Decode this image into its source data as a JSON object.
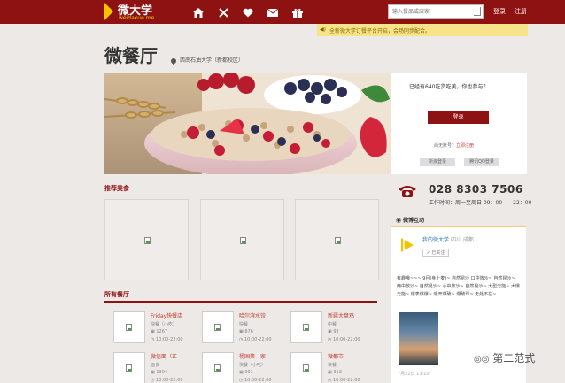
{
  "header": {
    "logo_text": "微大学",
    "logo_sub": "weidaxue.me",
    "nav_icons": [
      "home-icon",
      "utensils-icon",
      "heart-icon",
      "mail-icon",
      "gift-icon"
    ],
    "search_placeholder": "输入餐品或店家",
    "login_label": "登录",
    "register_label": "注册"
  },
  "notice": {
    "text": "全新微大学订餐平台开启，会场同步配合。"
  },
  "page": {
    "title": "微餐厅",
    "location": "西南石油大学（新都校区）"
  },
  "login_card": {
    "question": "已经有640吃货吃美，你也参与？",
    "button": "登录",
    "no_account": "尚无账号？",
    "register_link": "立即注册",
    "social_1": "新浪登录",
    "social_2": "腾讯QQ登录"
  },
  "contact": {
    "phone": "028 8303 7506",
    "hours": "工作时间：周一至周日 09：00——22：00"
  },
  "sections": {
    "recommend": "推荐美食",
    "restaurants": "所有餐厅",
    "weibo": "微博互动"
  },
  "weibo": {
    "name": "我的微大学",
    "location": "四川 成都",
    "follow": "已关注",
    "text": "有趣哦~~~ 9月(身上麦)~ 自然昆沙 口中放沙~ 自然昆沙~ 两中放沙~ 自然昆沙~ 心中放沙~ 自然昆沙~ 大型无能~ 大爆无能~ 爆表爆爆~ 爆开爆破~ 爆破球~ 无处不在~",
    "time": "7月22日 13:10"
  },
  "restaurants": [
    {
      "name": "Friday快餐店",
      "type": "快餐（小吃）",
      "count": "1267",
      "time": "10:00-22:00"
    },
    {
      "name": "哈尔滨水饺",
      "type": "快餐",
      "count": "876",
      "time": "10:00-22:00"
    },
    {
      "name": "新疆大盘鸡",
      "type": "中餐",
      "count": "92",
      "time": "10:00-22:00"
    },
    {
      "name": "微信面（正一",
      "type": "面食",
      "count": "1304",
      "time": "10:00-22:00"
    },
    {
      "name": "杨国第一家",
      "type": "快餐（小吃）",
      "count": "991",
      "time": "10:00-22:00"
    },
    {
      "name": "微都市",
      "type": "快餐",
      "count": "313",
      "time": "10:00-22:00"
    }
  ],
  "watermark": "第二范式",
  "colors": {
    "brand": "#8e1212",
    "notice_bg": "#f7e48a",
    "page_bg": "#ece9e7"
  }
}
